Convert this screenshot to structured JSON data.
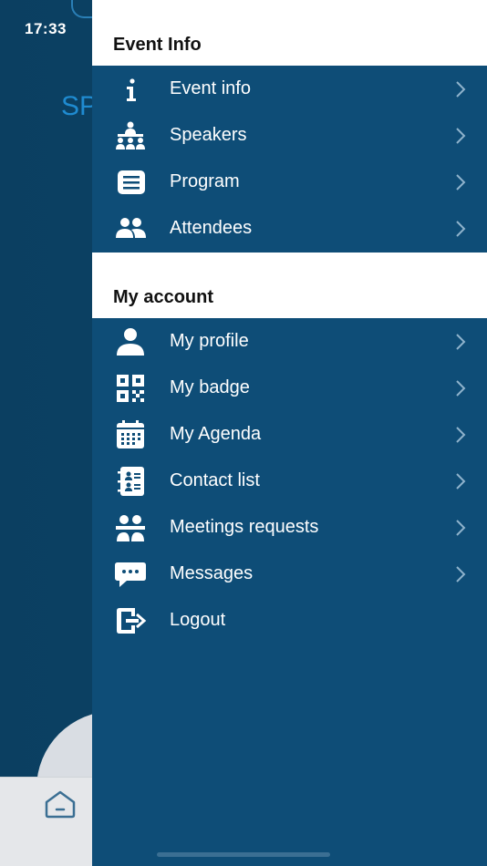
{
  "status_bar": {
    "time": "17:33"
  },
  "background": {
    "partial_text": "SP"
  },
  "sections": [
    {
      "title": "Event Info",
      "items": [
        {
          "label": "Event info",
          "icon": "info-icon",
          "chevron": true
        },
        {
          "label": "Speakers",
          "icon": "speakers-icon",
          "chevron": true
        },
        {
          "label": "Program",
          "icon": "program-icon",
          "chevron": true
        },
        {
          "label": "Attendees",
          "icon": "attendees-icon",
          "chevron": true
        }
      ]
    },
    {
      "title": "My account",
      "items": [
        {
          "label": "My profile",
          "icon": "user-icon",
          "chevron": true
        },
        {
          "label": "My badge",
          "icon": "qr-code-icon",
          "chevron": true
        },
        {
          "label": "My Agenda",
          "icon": "calendar-icon",
          "chevron": true
        },
        {
          "label": "Contact list",
          "icon": "address-book-icon",
          "chevron": true
        },
        {
          "label": "Meetings requests",
          "icon": "meetings-icon",
          "chevron": true
        },
        {
          "label": "Messages",
          "icon": "chat-icon",
          "chevron": true
        },
        {
          "label": "Logout",
          "icon": "logout-icon",
          "chevron": false
        }
      ]
    }
  ],
  "colors": {
    "drawer_bg": "#0e4d77",
    "header_bg": "#ffffff",
    "text": "#ffffff",
    "chevron": "#8fb3cc"
  }
}
